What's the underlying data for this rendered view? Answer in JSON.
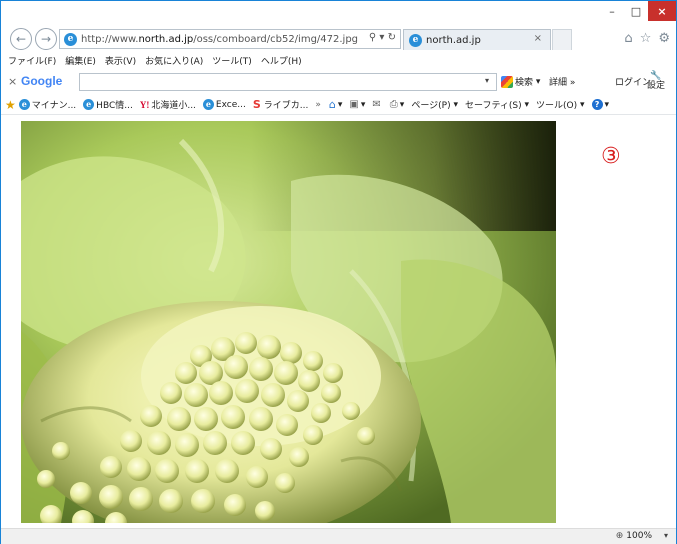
{
  "window": {
    "controls": {
      "minimize": "–",
      "maximize": "□",
      "close": "×"
    }
  },
  "address_bar": {
    "url_prefix": "http://www.",
    "url_host": "north.ad.jp",
    "url_path": "/oss/comboard/cb52/img/472.jpg",
    "search_icon": "search-icon",
    "refresh_icon": "refresh-icon"
  },
  "tab": {
    "title": "north.ad.jp",
    "close": "×"
  },
  "toolbar_icons": [
    "home-icon",
    "favorites-star-icon",
    "settings-gear-icon"
  ],
  "menu": {
    "items": [
      "ファイル(F)",
      "編集(E)",
      "表示(V)",
      "お気に入り(A)",
      "ツール(T)",
      "ヘルプ(H)"
    ]
  },
  "google_toolbar": {
    "close": "×",
    "logo": "Google",
    "search_value": "",
    "search_label": "検索",
    "more_label": "詳細 »",
    "login_label": "ログイン",
    "settings_label": "設定"
  },
  "favorites": {
    "items": [
      "マイナン...",
      "HBC情...",
      "北海道小...",
      "Exce...",
      "ライブカ..."
    ],
    "overflow": "»"
  },
  "command_bar": {
    "page_label": "ページ(P)",
    "safety_label": "セーフティ(S)",
    "tools_label": "ツール(O)"
  },
  "content": {
    "marker": "③",
    "photo_subject": "lettuce / cauliflower-like flower close-up"
  },
  "status_bar": {
    "zoom": "100%"
  },
  "colors": {
    "accent": "#1883d7",
    "close_button": "#c8302c",
    "marker": "#d81e1e"
  }
}
